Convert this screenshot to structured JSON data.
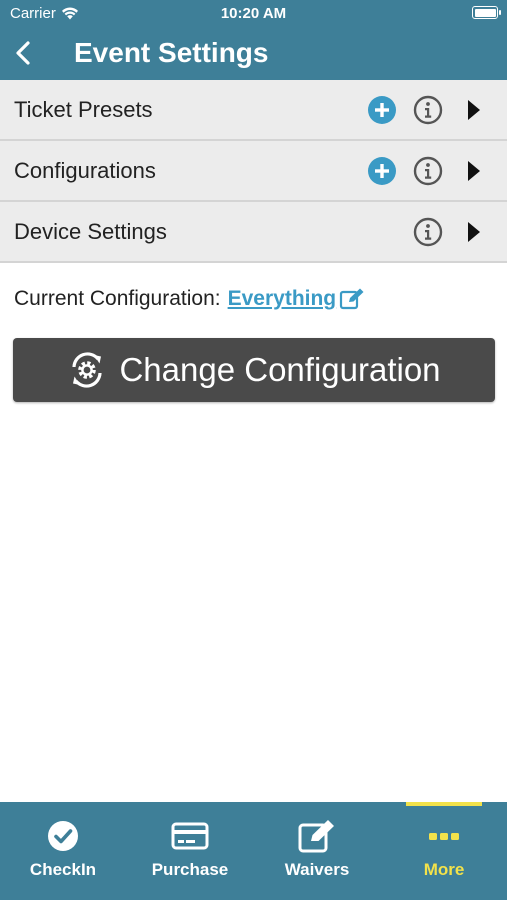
{
  "status_bar": {
    "carrier": "Carrier",
    "time": "10:20 AM"
  },
  "header": {
    "title": "Event Settings",
    "back_icon": "chevron-left-icon"
  },
  "settings": [
    {
      "label": "Ticket Presets",
      "has_add": true,
      "has_info": true
    },
    {
      "label": "Configurations",
      "has_add": true,
      "has_info": true
    },
    {
      "label": "Device Settings",
      "has_add": false,
      "has_info": true
    }
  ],
  "current_config": {
    "label": "Current Configuration:",
    "value": "Everything"
  },
  "change_button": {
    "label": "Change Configuration"
  },
  "tabs": [
    {
      "label": "CheckIn",
      "icon": "check-circle-icon",
      "active": false
    },
    {
      "label": "Purchase",
      "icon": "credit-card-icon",
      "active": false
    },
    {
      "label": "Waivers",
      "icon": "edit-icon",
      "active": false
    },
    {
      "label": "More",
      "icon": "more-icon",
      "active": true
    }
  ],
  "colors": {
    "primary": "#3e7f98",
    "add_blue": "#3a9ac5",
    "row_bg": "#ececec",
    "button_dark": "#4a4a4a",
    "active_tab": "#f2e24a"
  }
}
